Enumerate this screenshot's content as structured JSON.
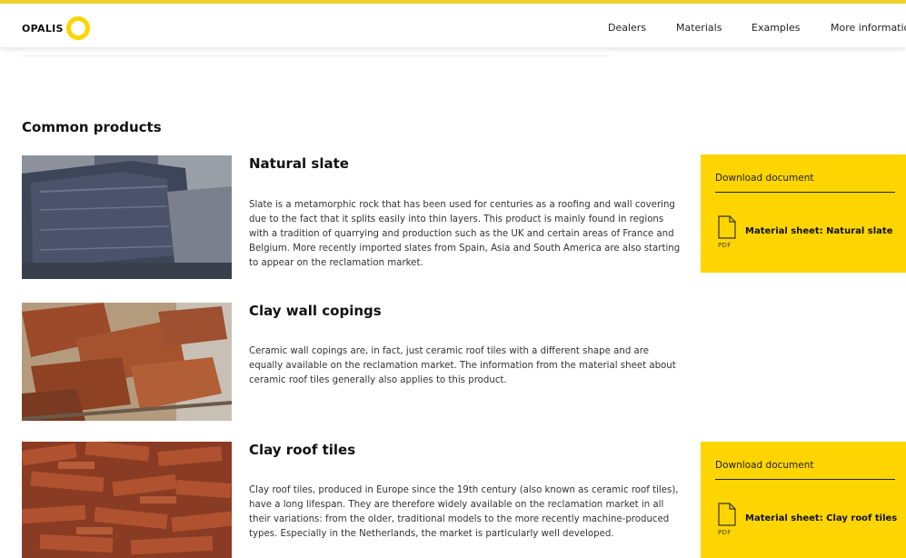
{
  "header": {
    "logo_text": "OPALIS",
    "nav": [
      {
        "label": "Dealers"
      },
      {
        "label": "Materials"
      },
      {
        "label": "Examples"
      },
      {
        "label": "More information"
      }
    ]
  },
  "section": {
    "title": "Common products"
  },
  "products": [
    {
      "title": "Natural slate",
      "description": "Slate is a metamorphic rock that has been used for centuries as a roofing and wall covering due to the fact that it splits easily into thin layers. This product is mainly found in regions with a tradition of quarrying and production such as the UK and certain areas of France and Belgium. More recently imported slates from Spain, Asia and South America are also starting to appear on the reclamation market.",
      "download": {
        "heading": "Download document",
        "file_type": "PDF",
        "link_label": "Material sheet: Natural slate"
      }
    },
    {
      "title": "Clay wall copings",
      "description": "Ceramic wall copings are, in fact, just ceramic roof tiles with a different shape and are equally available on the reclamation market. The information from the material sheet about ceramic roof tiles generally also applies to this product."
    },
    {
      "title": "Clay roof tiles",
      "description": "Clay roof tiles, produced in Europe since the 19th century (also known as ceramic roof tiles), have a long lifespan. They are therefore widely available on the reclamation market in all their variations: from the older, traditional models to the more recently machine-produced types. Especially in the Netherlands, the market is particularly well developed.",
      "download": {
        "heading": "Download document",
        "file_type": "PDF",
        "link_label": "Material sheet: Clay roof tiles"
      }
    }
  ],
  "colors": {
    "accent": "#ffd500",
    "topline": "#f3d22a"
  }
}
